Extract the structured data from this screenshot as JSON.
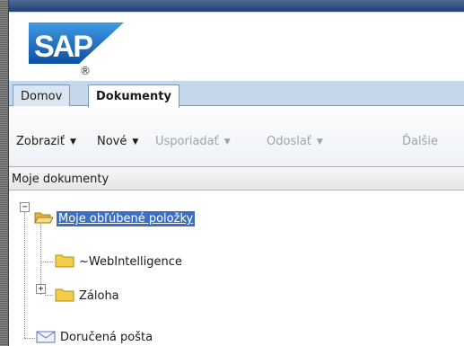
{
  "logo": {
    "text": "SAP",
    "mark": "®"
  },
  "tabs": [
    {
      "label": "Domov",
      "active": false
    },
    {
      "label": "Dokumenty",
      "active": true
    }
  ],
  "toolbar": {
    "items": [
      {
        "label": "Zobraziť",
        "enabled": true,
        "has_dropdown": true
      },
      {
        "label": "Nové",
        "enabled": true,
        "has_dropdown": true
      },
      {
        "label": "Usporiadať",
        "enabled": false,
        "has_dropdown": true
      },
      {
        "label": "Odoslať",
        "enabled": false,
        "has_dropdown": true
      },
      {
        "label": "Ďalšie",
        "enabled": false,
        "has_dropdown": false
      }
    ]
  },
  "panel": {
    "title": "Moje dokumenty"
  },
  "tree": {
    "root": {
      "label": "Moje obľúbené položky",
      "icon": "open-folder-icon",
      "expanded": true,
      "selected": true
    },
    "children": [
      {
        "label": "~WebIntelligence",
        "icon": "folder-icon",
        "expandable": false
      },
      {
        "label": "Záloha",
        "icon": "folder-icon",
        "expandable": true
      }
    ],
    "sibling": {
      "label": "Doručená pošta",
      "icon": "inbox-icon"
    }
  },
  "colors": {
    "selection": "#3a6fc4",
    "tab_bar": "#c6d7ec",
    "brand_blue": "#1f63b8"
  }
}
